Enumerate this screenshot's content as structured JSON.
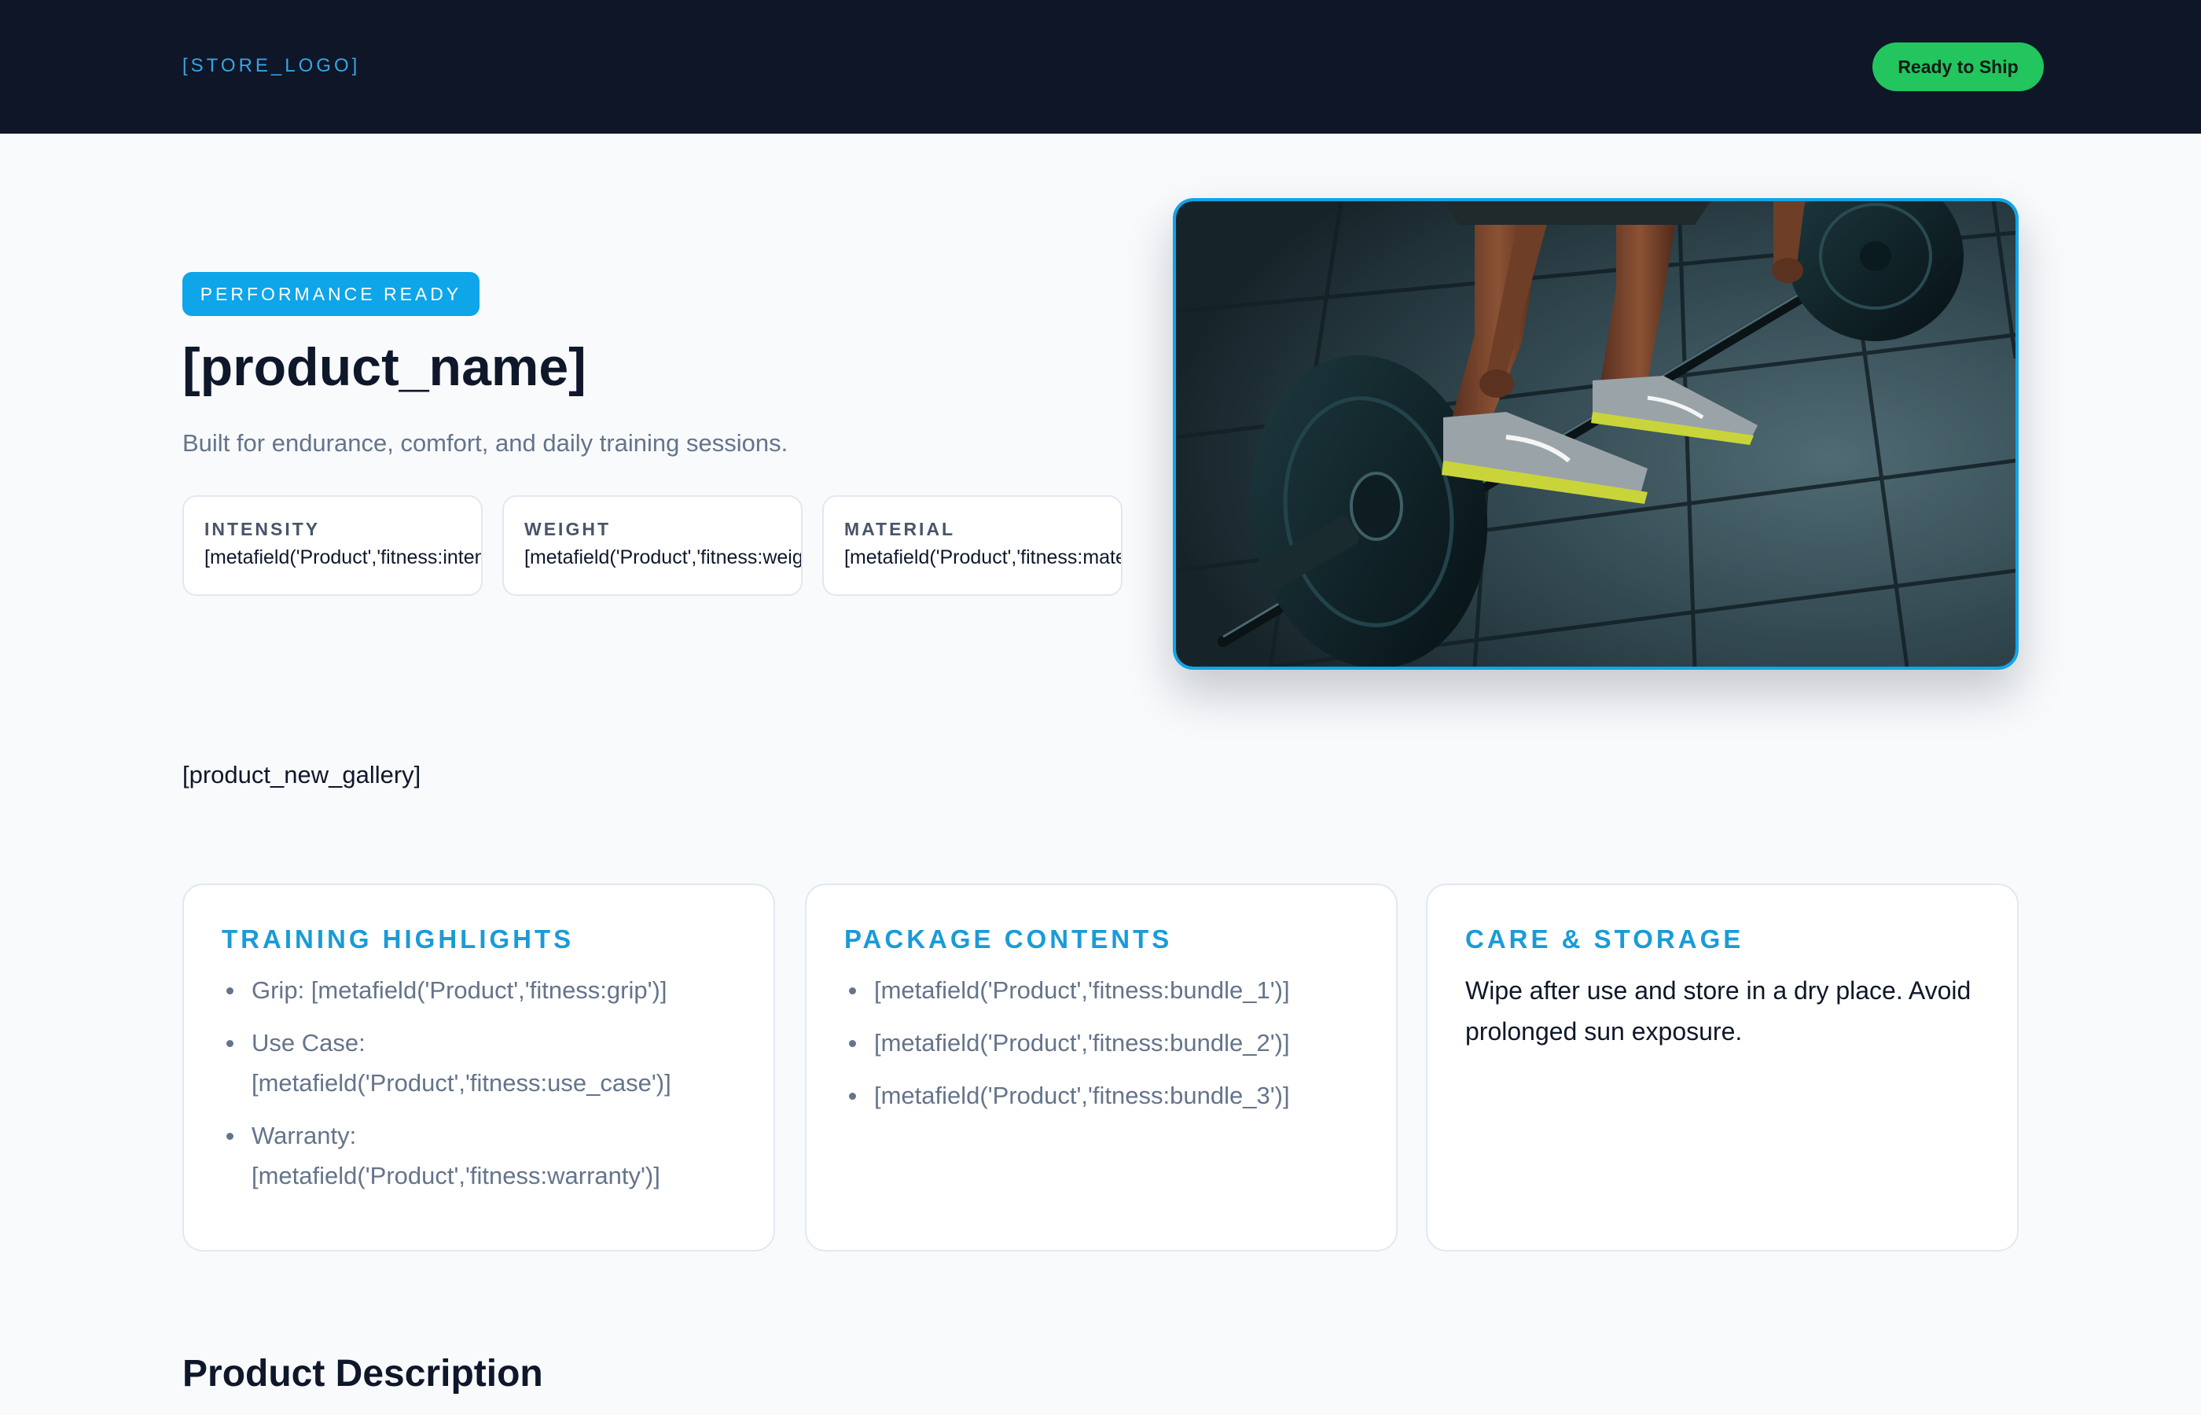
{
  "header": {
    "logo": "[STORE_LOGO]",
    "status_badge": "Ready to Ship"
  },
  "hero": {
    "badge": "PERFORMANCE READY",
    "title": "[product_name]",
    "subtitle": "Built for endurance, comfort, and daily training sessions.",
    "specs": [
      {
        "label": "INTENSITY",
        "value": "[metafield('Product','fitness:intensity')]"
      },
      {
        "label": "WEIGHT",
        "value": "[metafield('Product','fitness:weight')]"
      },
      {
        "label": "MATERIAL",
        "value": "[metafield('Product','fitness:material')]"
      }
    ],
    "image_subject": "barbell-deadlift-photo"
  },
  "gallery": {
    "placeholder": "[product_new_gallery]"
  },
  "cards": [
    {
      "title": "TRAINING HIGHLIGHTS",
      "items": [
        "Grip: [metafield('Product','fitness:grip')]",
        "Use Case: [metafield('Product','fitness:use_case')]",
        "Warranty: [metafield('Product','fitness:warranty')]"
      ]
    },
    {
      "title": "PACKAGE CONTENTS",
      "items": [
        "[metafield('Product','fitness:bundle_1')]",
        "[metafield('Product','fitness:bundle_2')]",
        "[metafield('Product','fitness:bundle_3')]"
      ]
    },
    {
      "title": "CARE & STORAGE",
      "body": "Wipe after use and store in a dry place. Avoid prolonged sun exposure."
    }
  ],
  "description": {
    "heading": "Product Description"
  },
  "colors": {
    "header_bg": "#0e1628",
    "accent": "#0ea5e9",
    "success": "#22c55e",
    "page_bg": "#f8fafc"
  }
}
